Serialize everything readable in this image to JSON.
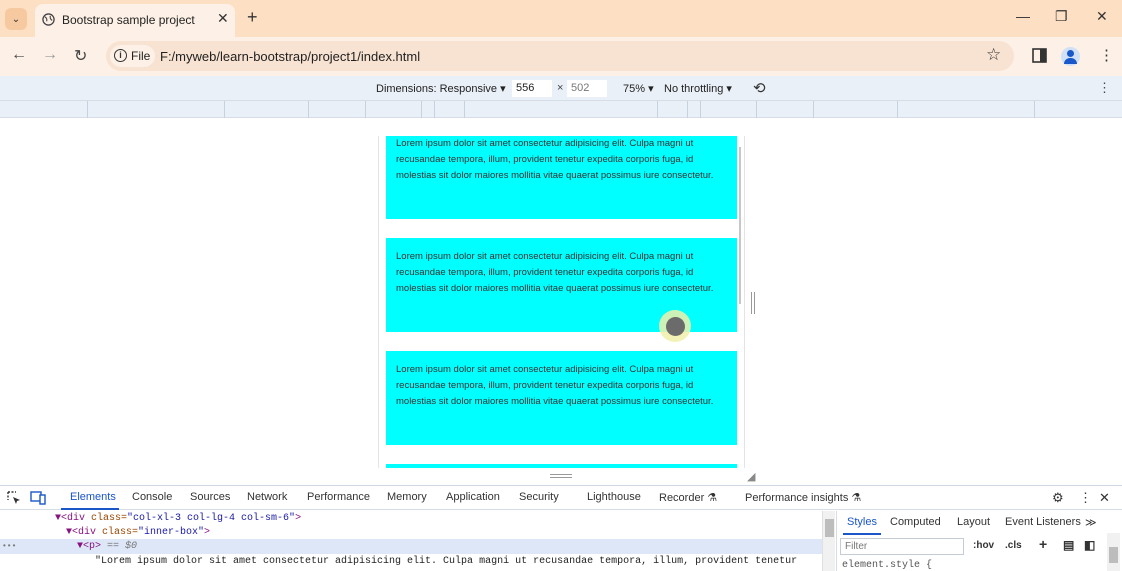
{
  "browser": {
    "tab_title": "Bootstrap sample project",
    "tab_close": "✕",
    "new_tab": "+",
    "window_controls": {
      "minimize": "—",
      "restore": "❐",
      "close": "✕"
    },
    "site_chip_label": "File",
    "url": "F:/myweb/learn-bootstrap/project1/index.html"
  },
  "device_toolbar": {
    "dimensions_label": "Dimensions: Responsive ▾",
    "width": "556",
    "height": "502",
    "times": "×",
    "zoom": "75% ▾",
    "throttling": "No throttling ▾"
  },
  "page": {
    "paragraph_text": "Lorem ipsum dolor sit amet consectetur adipisicing elit. Culpa magni ut recusandae tempora, illum, provident tenetur expedita corporis fuga, id molestias sit dolor maiores mollitia vitae quaerat possimus iure consectetur.",
    "box_color": "#00ffff"
  },
  "devtools": {
    "tabs": [
      "Elements",
      "Console",
      "Sources",
      "Network",
      "Performance",
      "Memory",
      "Application",
      "Security",
      "Lighthouse",
      "Recorder ⚗",
      "Performance insights ⚗"
    ],
    "active_tab": "Elements",
    "dom": {
      "line1_tag_open": "▼<div",
      "line1_attr_name": " class=",
      "line1_attr_value": "\"col-xl-3 col-lg-4 col-sm-6\"",
      "line1_tag_close": ">",
      "line2_tag_open": "▼<div",
      "line2_attr_name": " class=",
      "line2_attr_value": "\"inner-box\"",
      "line2_tag_close": ">",
      "line3_dots": "•••",
      "line3_tag": "▼<p>",
      "line3_suffix": " == $0",
      "line4_text": "\"Lorem ipsum dolor sit amet consectetur adipisicing elit. Culpa magni ut recusandae tempora, illum, provident tenetur"
    },
    "styles_tabs": [
      "Styles",
      "Computed",
      "Layout",
      "Event Listeners",
      "≫"
    ],
    "filter_placeholder": "Filter",
    "hov_label": ":hov",
    "cls_label": ".cls",
    "element_style": "element.style {"
  }
}
